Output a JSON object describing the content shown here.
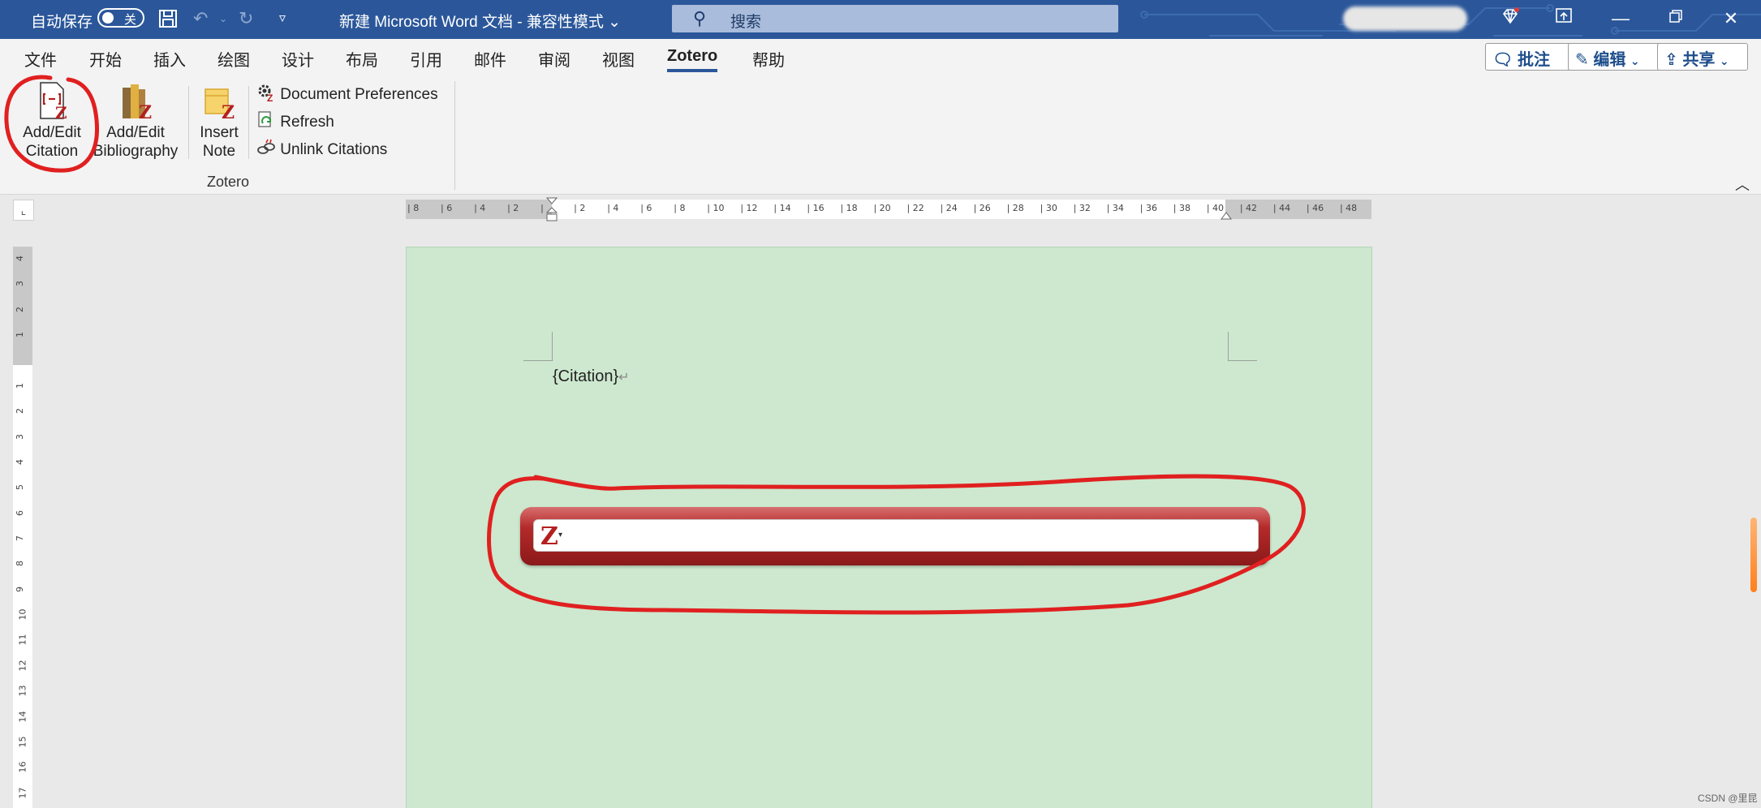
{
  "titlebar": {
    "autosave_label": "自动保存",
    "autosave_state": "关",
    "doc_title": "新建 Microsoft Word 文档 - 兼容性模式",
    "search_placeholder": "搜索"
  },
  "menu": {
    "tabs": [
      "文件",
      "开始",
      "插入",
      "绘图",
      "设计",
      "布局",
      "引用",
      "邮件",
      "审阅",
      "视图",
      "Zotero",
      "帮助"
    ],
    "active_tab": "Zotero",
    "comment_label": "批注",
    "edit_label": "编辑",
    "share_label": "共享"
  },
  "ribbon": {
    "add_edit_citation": [
      "Add/Edit",
      "Citation"
    ],
    "add_edit_bibliography": [
      "Add/Edit",
      "Bibliography"
    ],
    "insert_note": [
      "Insert",
      "Note"
    ],
    "document_preferences": "Document Preferences",
    "refresh": "Refresh",
    "unlink_citations": "Unlink Citations",
    "group_label": "Zotero"
  },
  "ruler": {
    "h_ticks": [
      "8",
      "6",
      "4",
      "2",
      "",
      "2",
      "4",
      "6",
      "8",
      "10",
      "12",
      "14",
      "16",
      "18",
      "20",
      "22",
      "24",
      "26",
      "28",
      "30",
      "32",
      "34",
      "36",
      "38",
      "40",
      "42",
      "44",
      "46",
      "48"
    ],
    "v_ticks": [
      "4",
      "3",
      "2",
      "1",
      "",
      "1",
      "2",
      "3",
      "4",
      "5",
      "6",
      "7",
      "8",
      "9",
      "10",
      "11",
      "12",
      "13",
      "14",
      "15",
      "16",
      "17"
    ]
  },
  "document": {
    "citation_placeholder": "{Citation}",
    "paragraph_mark": "↵"
  },
  "zotero_bar": {
    "logo": "Z",
    "caret": "▾",
    "input_value": ""
  },
  "watermark": "CSDN @里昆",
  "colors": {
    "titlebar": "#2b579a",
    "page_bg": "#cde8cf",
    "zotero_red": "#b3201f",
    "annotation_red": "#e02020"
  }
}
